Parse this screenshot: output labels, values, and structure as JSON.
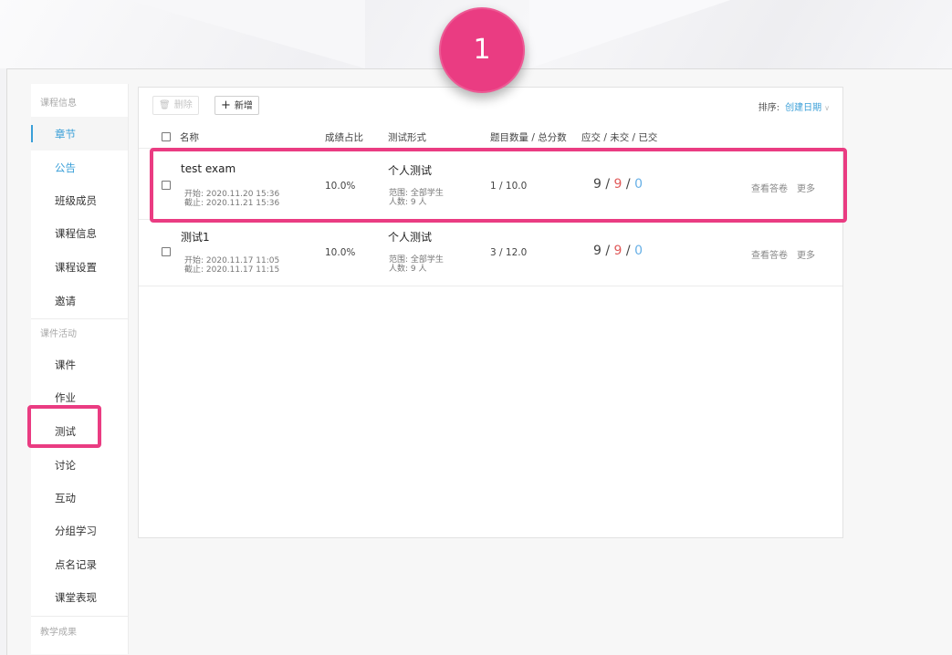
{
  "step_badge": "1",
  "sidebar": {
    "sections": [
      {
        "title": "课程信息",
        "items": [
          {
            "label": "章节",
            "state": "active"
          },
          {
            "label": "公告",
            "state": "teal"
          },
          {
            "label": "班级成员"
          },
          {
            "label": "课程信息"
          },
          {
            "label": "课程设置"
          },
          {
            "label": "邀请"
          }
        ]
      },
      {
        "title": "课件活动",
        "items": [
          {
            "label": "课件"
          },
          {
            "label": "作业"
          },
          {
            "label": "测试",
            "highlighted": true
          },
          {
            "label": "讨论"
          },
          {
            "label": "互动"
          },
          {
            "label": "分组学习"
          },
          {
            "label": "点名记录"
          },
          {
            "label": "课堂表现"
          }
        ]
      },
      {
        "title": "教学成果",
        "items": []
      }
    ]
  },
  "toolbar": {
    "delete_label": "删除",
    "add_label": "新增",
    "sort_label": "排序:",
    "sort_value": "创建日期"
  },
  "table": {
    "headers": {
      "name": "名称",
      "percent": "成绩占比",
      "mode": "测试形式",
      "questions": "题目数量 / 总分数",
      "stats": "应交 / 未交 / 已交"
    },
    "rows": [
      {
        "name": "test exam",
        "start": "开始:  2020.11.20 15:36",
        "end": "截止:  2020.11.21 15:36",
        "percent": "10.0%",
        "mode": "个人测试",
        "scope": "范围:  全部学生",
        "count": "人数:  9 人",
        "questions": "1 / 10.0",
        "should": "9",
        "not_submitted": "9",
        "submitted": "0",
        "action_view": "查看答卷",
        "action_more": "更多",
        "highlighted": true
      },
      {
        "name": "测试1",
        "start": "开始:  2020.11.17 11:05",
        "end": "截止:  2020.11.17 11:15",
        "percent": "10.0%",
        "mode": "个人测试",
        "scope": "范围:  全部学生",
        "count": "人数:  9 人",
        "questions": "3 / 12.0",
        "should": "9",
        "not_submitted": "9",
        "submitted": "0",
        "action_view": "查看答卷",
        "action_more": "更多"
      }
    ]
  },
  "colors": {
    "accent": "#3a9fd8",
    "highlight": "#ea3c82",
    "red": "#e05a5a",
    "blue": "#68b0e6"
  }
}
